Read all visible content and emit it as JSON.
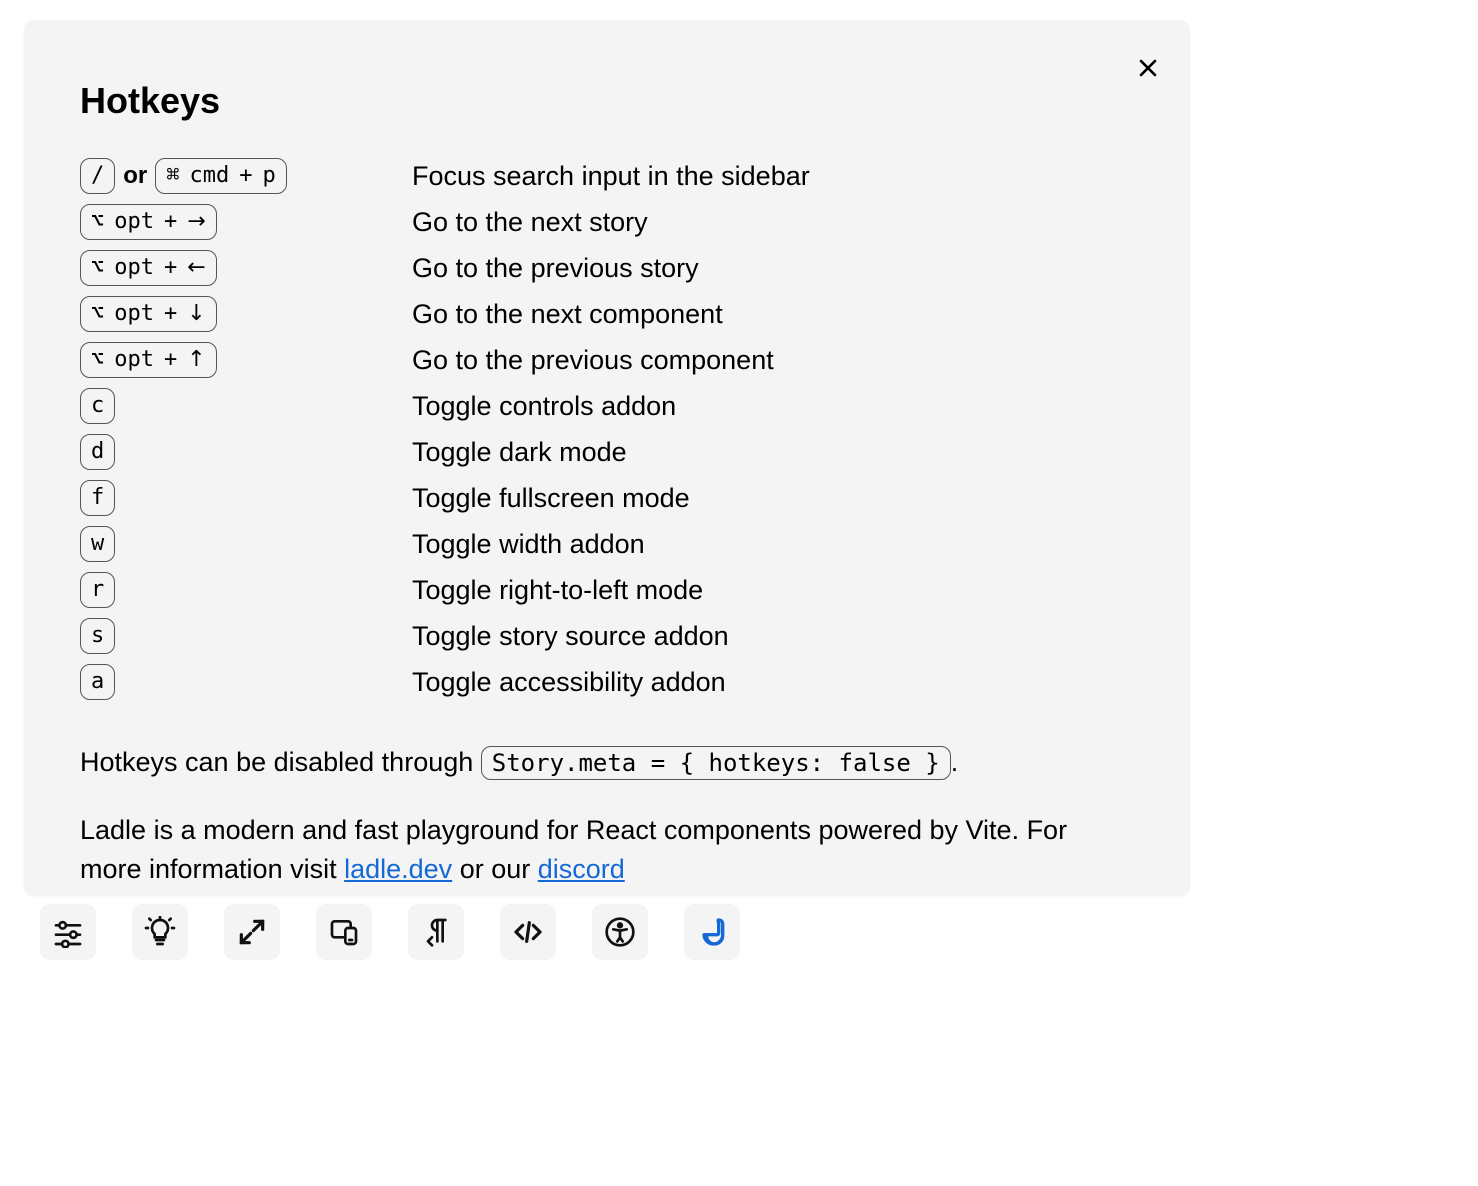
{
  "modal": {
    "title": "Hotkeys",
    "or_label": "or",
    "rows": [
      {
        "keys": [
          [
            "/"
          ],
          [
            "⌘",
            "cmd",
            "+",
            "p"
          ]
        ],
        "has_or": true,
        "desc": "Focus search input in the sidebar"
      },
      {
        "keys": [
          [
            "⌥",
            "opt",
            "+",
            "→"
          ]
        ],
        "has_or": false,
        "desc": "Go to the next story"
      },
      {
        "keys": [
          [
            "⌥",
            "opt",
            "+",
            "←"
          ]
        ],
        "has_or": false,
        "desc": "Go to the previous story"
      },
      {
        "keys": [
          [
            "⌥",
            "opt",
            "+",
            "↓"
          ]
        ],
        "has_or": false,
        "desc": "Go to the next component"
      },
      {
        "keys": [
          [
            "⌥",
            "opt",
            "+",
            "↑"
          ]
        ],
        "has_or": false,
        "desc": "Go to the previous component"
      },
      {
        "keys": [
          [
            "c"
          ]
        ],
        "has_or": false,
        "desc": "Toggle controls addon"
      },
      {
        "keys": [
          [
            "d"
          ]
        ],
        "has_or": false,
        "desc": "Toggle dark mode"
      },
      {
        "keys": [
          [
            "f"
          ]
        ],
        "has_or": false,
        "desc": "Toggle fullscreen mode"
      },
      {
        "keys": [
          [
            "w"
          ]
        ],
        "has_or": false,
        "desc": "Toggle width addon"
      },
      {
        "keys": [
          [
            "r"
          ]
        ],
        "has_or": false,
        "desc": "Toggle right-to-left mode"
      },
      {
        "keys": [
          [
            "s"
          ]
        ],
        "has_or": false,
        "desc": "Toggle story source addon"
      },
      {
        "keys": [
          [
            "a"
          ]
        ],
        "has_or": false,
        "desc": "Toggle accessibility addon"
      }
    ],
    "disable_note_prefix": "Hotkeys can be disabled through ",
    "disable_note_code": "Story.meta = { hotkeys: false }",
    "disable_note_suffix": ".",
    "about_prefix": "Ladle is a modern and fast playground for React components powered by Vite. For more information visit ",
    "about_link1": "ladle.dev",
    "about_mid": " or our ",
    "about_link2": "discord"
  },
  "addons": [
    {
      "id": "controls",
      "active": false
    },
    {
      "id": "theme",
      "active": false
    },
    {
      "id": "fullscreen",
      "active": false
    },
    {
      "id": "width",
      "active": false
    },
    {
      "id": "rtl",
      "active": false
    },
    {
      "id": "source",
      "active": false
    },
    {
      "id": "a11y",
      "active": false
    },
    {
      "id": "ladle",
      "active": true
    }
  ]
}
